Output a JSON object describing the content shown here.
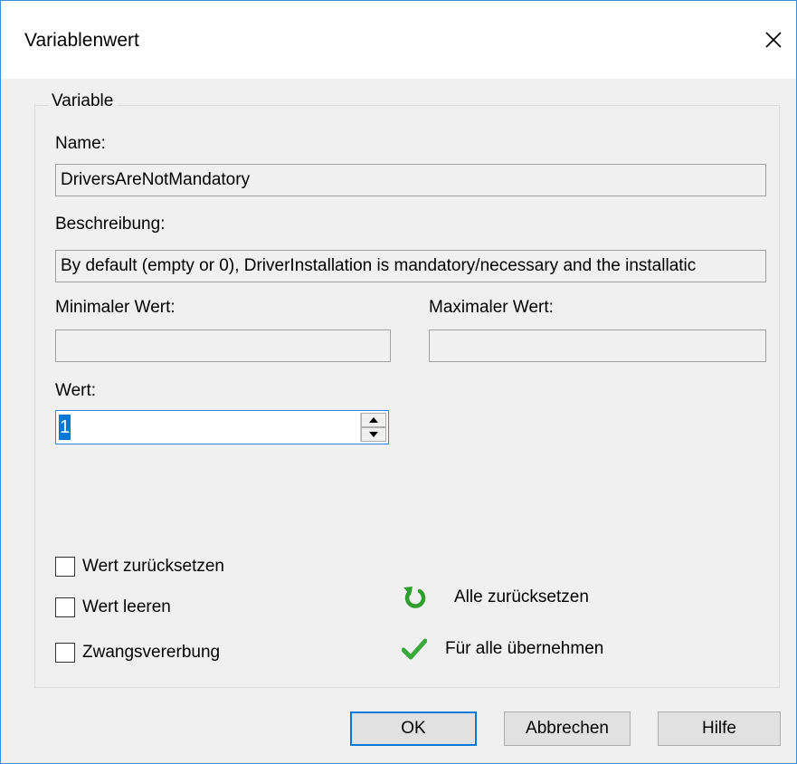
{
  "dialog": {
    "title": "Variablenwert"
  },
  "group": {
    "legend": "Variable",
    "name_label": "Name:",
    "name_value": "DriversAreNotMandatory",
    "description_label": "Beschreibung:",
    "description_value": "By default (empty or 0), DriverInstallation is mandatory/necessary and the installatic",
    "min_label": "Minimaler Wert:",
    "min_value": "",
    "max_label": "Maximaler Wert:",
    "max_value": "",
    "value_label": "Wert:",
    "value": "1"
  },
  "options": {
    "reset_value": "Wert zurücksetzen",
    "clear_value": "Wert leeren",
    "force_inherit": "Zwangsvererbung"
  },
  "actions": {
    "reset_all": "Alle zurücksetzen",
    "apply_all": "Für alle übernehmen"
  },
  "buttons": {
    "ok": "OK",
    "cancel": "Abbrechen",
    "help": "Hilfe"
  },
  "colors": {
    "accent": "#0078d7",
    "reset_icon": "#2e9e2e",
    "check_icon": "#3aa93a"
  }
}
